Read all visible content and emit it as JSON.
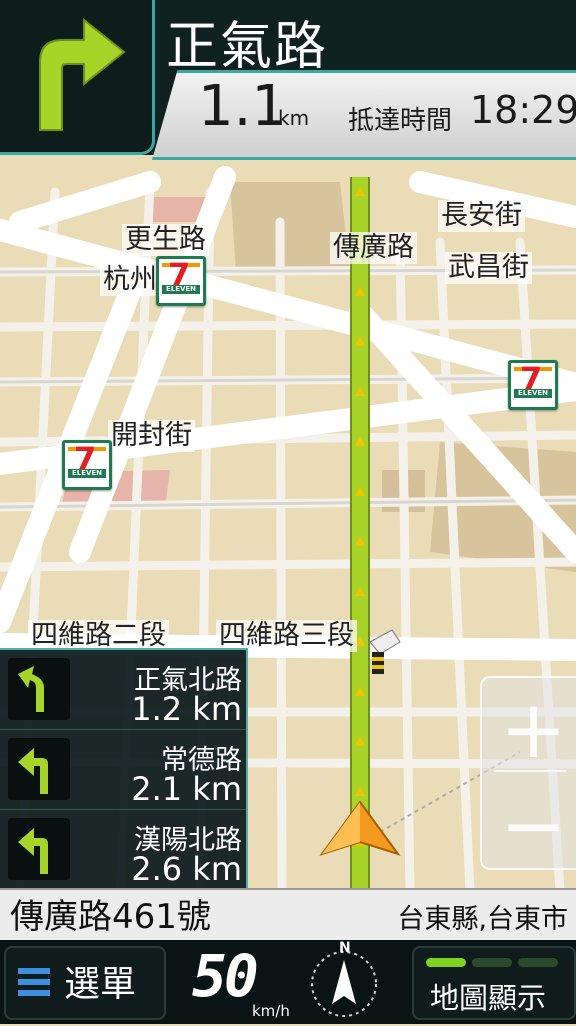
{
  "header": {
    "next_street": "正氣路",
    "distance_value": "1.1",
    "distance_unit": "km",
    "arrival_label": "抵達時間",
    "arrival_time": "18:29"
  },
  "map": {
    "labels": {
      "l1": "長安街",
      "l2": "更生路",
      "l3": "傳廣路",
      "l4": "武昌街",
      "l5": "杭州街",
      "l6": "開封街",
      "l7": "四維路二段",
      "l8": "四維路三段"
    },
    "store_logo_text": "7",
    "store_logo_banner": "ELEVEN"
  },
  "upcoming_turns": [
    {
      "street": "正氣北路",
      "distance": "1.2 km",
      "icon": "turn-slight-left-icon"
    },
    {
      "street": "常德路",
      "distance": "2.1 km",
      "icon": "turn-left-icon"
    },
    {
      "street": "漢陽北路",
      "distance": "2.6 km",
      "icon": "turn-left-icon"
    }
  ],
  "zoom": {
    "in_label": "+",
    "out_label": "−"
  },
  "address": {
    "street": "傳廣路461號",
    "region": "台東縣,台東市"
  },
  "bottom": {
    "menu_label": "選單",
    "speed_value": "50",
    "speed_unit": "km/h",
    "compass_north": "N",
    "map_display_label": "地圖顯示"
  },
  "colors": {
    "route": "#a8d42a",
    "accent": "#38a9a0",
    "turn_arrow": "#a8d42a",
    "signal_active": "#7ed321"
  }
}
